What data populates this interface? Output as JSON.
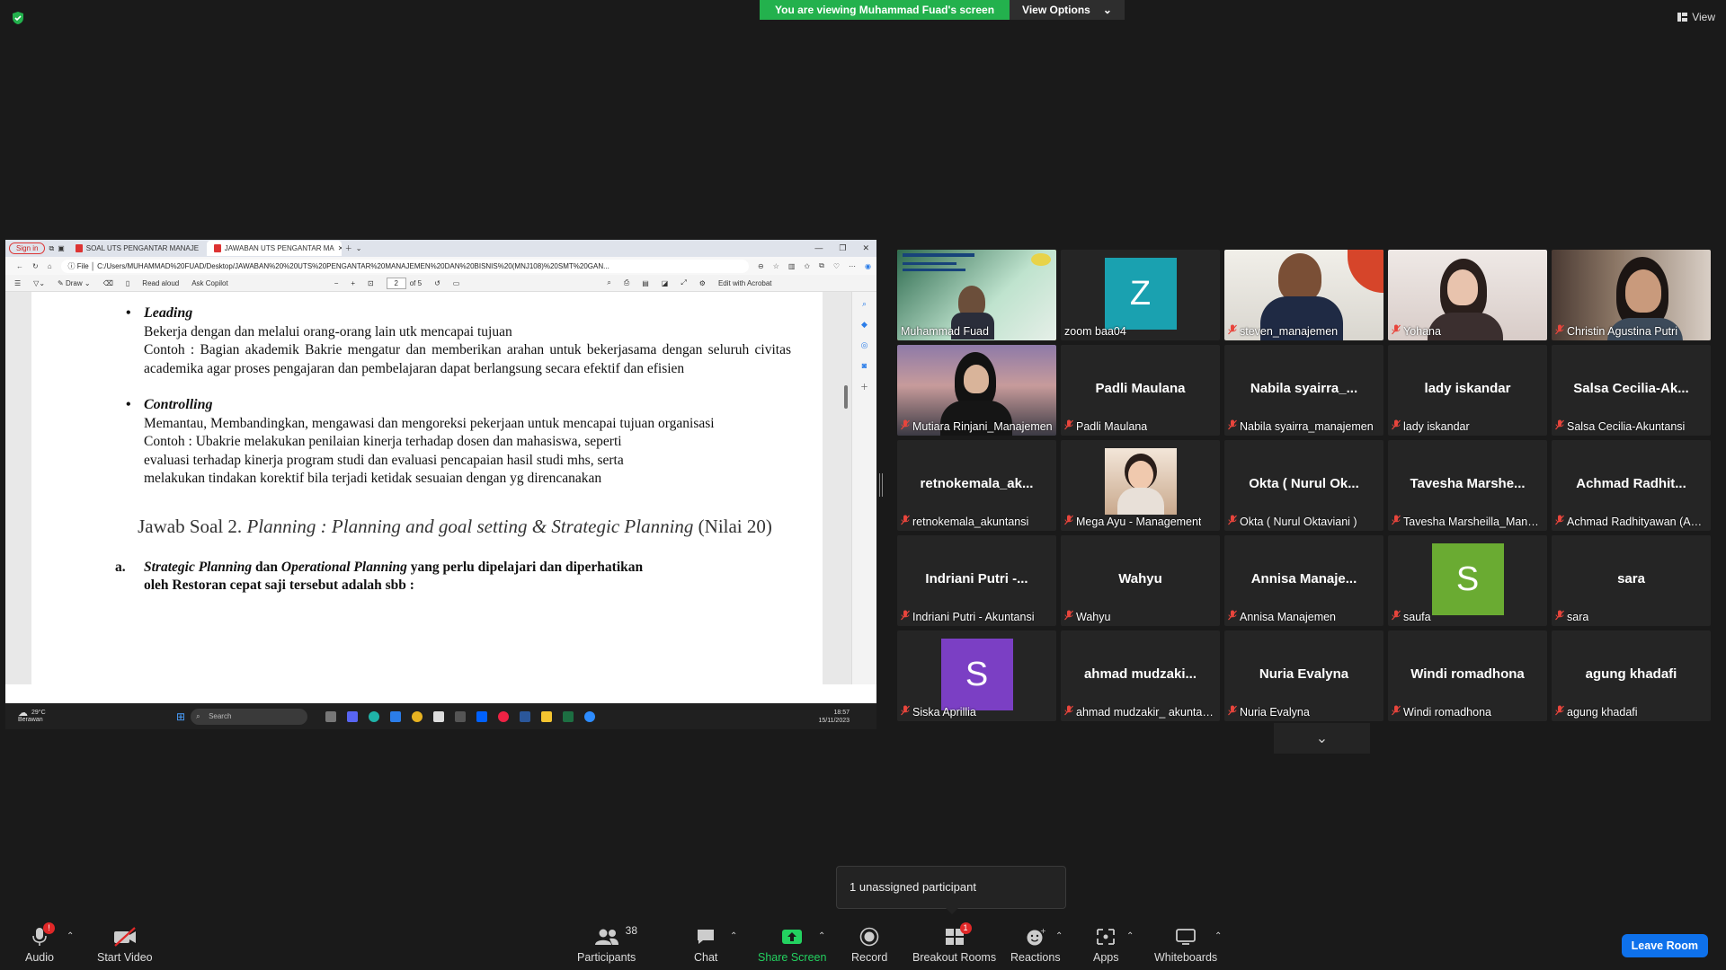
{
  "banner": {
    "viewing_text": "You are viewing Muhammad Fuad's screen",
    "view_options": "View Options",
    "top_view": "View"
  },
  "browser": {
    "signin": "Sign in",
    "tabs": [
      {
        "label": "SOAL UTS PENGANTAR MANAJE",
        "active": false
      },
      {
        "label": "JAWABAN UTS PENGANTAR MA",
        "active": true
      }
    ],
    "url_prefix": "File",
    "url": "C:/Users/MUHAMMAD%20FUAD/Desktop/JAWABAN%20%20UTS%20PENGANTAR%20MANAJEMEN%20DAN%20BISNIS%20(MNJ108)%20SMT%20GAN...",
    "pdf_toolbar": {
      "draw": "Draw",
      "read_aloud": "Read aloud",
      "ask_copilot": "Ask Copilot",
      "page_current": "2",
      "page_total": "of 5",
      "edit_acrobat": "Edit with Acrobat"
    }
  },
  "document": {
    "leading_title": "Leading",
    "leading_line1": "Bekerja dengan dan melalui orang-orang lain utk mencapai tujuan",
    "leading_example": "Contoh : Bagian akademik Bakrie mengatur dan memberikan arahan untuk  bekerjasama dengan seluruh civitas academika agar proses pengajaran dan pembelajaran dapat berlangsung secara efektif dan efisien",
    "controlling_title": "Controlling",
    "controlling_line1": "Memantau, Membandingkan, mengawasi dan mengoreksi pekerjaan untuk mencapai tujuan organisasi",
    "controlling_example_1": "Contoh : Ubakrie melakukan penilaian kinerja terhadap dosen dan mahasiswa, seperti",
    "controlling_example_2": "evaluasi terhadap kinerja program studi dan evaluasi pencapaian hasil studi mhs, serta",
    "controlling_example_3": "melakukan tindakan korektif bila terjadi ketidak sesuaian dengan yg direncanakan",
    "soal_prefix": "Jawab Soal 2.",
    "soal_italic": "Planning : Planning and goal setting & Strategic Planning",
    "soal_suffix": "(Nilai 20)",
    "item_a_label": "a.",
    "item_a_italic1": "Strategic Planning",
    "item_a_dan": "dan",
    "item_a_italic2": "Operational Planning",
    "item_a_rest": "yang perlu dipelajari dan diperhatikan",
    "item_a_line2": "oleh Restoran cepat saji tersebut adalah sbb :"
  },
  "taskbar": {
    "temp": "29°C",
    "weather": "Berawan",
    "search": "Search",
    "time": "18:57",
    "date": "15/11/2023"
  },
  "participants": [
    {
      "name": "Muhammad Fuad",
      "type": "video",
      "active": true,
      "muted": false
    },
    {
      "name": "zoom baa04",
      "type": "avatar",
      "letter": "Z",
      "color": "#1aa1b0",
      "muted": false
    },
    {
      "name": "steven_manajemen",
      "type": "video",
      "muted": true
    },
    {
      "name": "Yohana",
      "type": "video",
      "muted": true
    },
    {
      "name": "Christin Agustina Putri",
      "type": "video",
      "muted": true
    },
    {
      "name": "Mutiara Rinjani_Manajemen",
      "type": "video",
      "muted": true
    },
    {
      "name": "Padli Maulana",
      "big": "Padli Maulana",
      "type": "name",
      "muted": true
    },
    {
      "name": "Nabila syairra_manajemen",
      "big": "Nabila  syairra_...",
      "type": "name",
      "muted": true
    },
    {
      "name": "lady iskandar",
      "big": "lady iskandar",
      "type": "name",
      "muted": true
    },
    {
      "name": "Salsa Cecilia-Akuntansi",
      "big": "Salsa  Cecilia-Ak...",
      "type": "name",
      "muted": true
    },
    {
      "name": "retnokemala_akuntansi",
      "big": "retnokemala_ak...",
      "type": "name",
      "muted": true
    },
    {
      "name": "Mega Ayu - Management",
      "type": "photo",
      "muted": true
    },
    {
      "name": "Okta ( Nurul Oktaviani )",
      "big": "Okta  ( Nurul Ok...",
      "type": "name",
      "muted": true
    },
    {
      "name": "Tavesha Marsheilla_Manajemen",
      "big": "Tavesha  Marshe...",
      "type": "name",
      "muted": true
    },
    {
      "name": "Achmad Radhityawan (Akuntansi)",
      "big": "Achmad  Radhit...",
      "type": "name",
      "muted": true
    },
    {
      "name": "Indriani Putri - Akuntansi",
      "big": "Indriani  Putri  -...",
      "type": "name",
      "muted": true
    },
    {
      "name": "Wahyu",
      "big": "Wahyu",
      "type": "name",
      "muted": true
    },
    {
      "name": "Annisa Manajemen",
      "big": "Annisa  Manaje...",
      "type": "name",
      "muted": true
    },
    {
      "name": "saufa",
      "type": "avatar",
      "letter": "S",
      "color": "#6aab32",
      "muted": true
    },
    {
      "name": "sara",
      "big": "sara",
      "type": "name",
      "muted": true
    },
    {
      "name": "Siska Aprillia",
      "type": "avatar",
      "letter": "S",
      "color": "#7b3fc4",
      "muted": true
    },
    {
      "name": "ahmad mudzakir_ akuntansi",
      "big": "ahmad  mudzaki...",
      "type": "name",
      "muted": true
    },
    {
      "name": "Nuria Evalyna",
      "big": "Nuria Evalyna",
      "type": "name",
      "muted": true
    },
    {
      "name": "Windi romadhona",
      "big": "Windi romadhona",
      "type": "name",
      "muted": true
    },
    {
      "name": "agung khadafi",
      "big": "agung khadafi",
      "type": "name",
      "muted": true
    }
  ],
  "popover": {
    "text": "1 unassigned participant"
  },
  "toolbar": {
    "audio": "Audio",
    "audio_badge": "!",
    "start_video": "Start Video",
    "participants": "Participants",
    "participants_count": "38",
    "chat": "Chat",
    "share_screen": "Share Screen",
    "record": "Record",
    "breakout_rooms": "Breakout Rooms",
    "breakout_badge": "1",
    "reactions": "Reactions",
    "apps": "Apps",
    "whiteboards": "Whiteboards",
    "leave_room": "Leave Room"
  }
}
